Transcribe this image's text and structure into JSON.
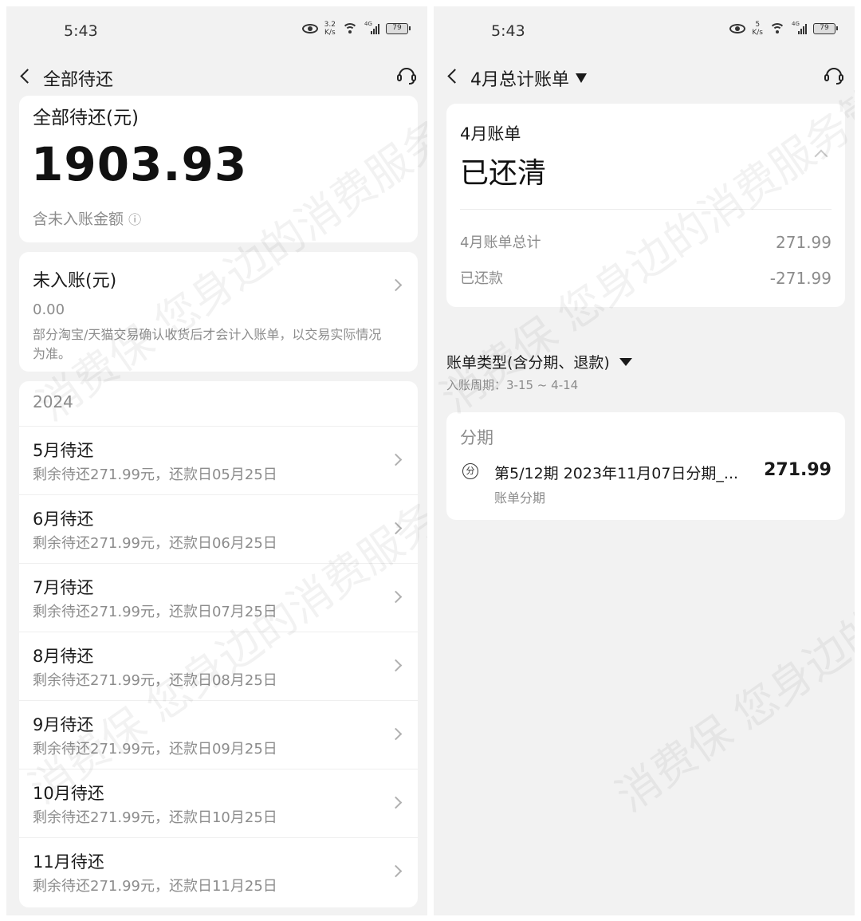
{
  "left": {
    "status": {
      "time": "5:43",
      "speed_value": "3.2",
      "speed_unit": "K/s",
      "network": "4G",
      "battery": "79"
    },
    "nav": {
      "title": "全部待还"
    },
    "summary": {
      "label": "全部待还(元)",
      "amount": "1903.93",
      "note": "含未入账金额",
      "info_icon": "ⓘ"
    },
    "pending": {
      "title": "未入账(元)",
      "amount": "0.00",
      "desc": "部分淘宝/天猫交易确认收货后才会计入账单，以交易实际情况为准。"
    },
    "year": "2024",
    "months": [
      {
        "title": "5月待还",
        "detail": "剩余待还271.99元，还款日05月25日"
      },
      {
        "title": "6月待还",
        "detail": "剩余待还271.99元，还款日06月25日"
      },
      {
        "title": "7月待还",
        "detail": "剩余待还271.99元，还款日07月25日"
      },
      {
        "title": "8月待还",
        "detail": "剩余待还271.99元，还款日08月25日"
      },
      {
        "title": "9月待还",
        "detail": "剩余待还271.99元，还款日09月25日"
      },
      {
        "title": "10月待还",
        "detail": "剩余待还271.99元，还款日10月25日"
      },
      {
        "title": "11月待还",
        "detail": "剩余待还271.99元，还款日11月25日"
      }
    ]
  },
  "right": {
    "status": {
      "time": "5:43",
      "speed_value": "5",
      "speed_unit": "K/s",
      "network": "4G",
      "battery": "79"
    },
    "nav": {
      "title": "4月总计账单"
    },
    "bill": {
      "label": "4月账单",
      "status": "已还清",
      "total_label": "4月账单总计",
      "total_value": "271.99",
      "paid_label": "已还款",
      "paid_value": "-271.99"
    },
    "filter": {
      "label": "账单类型(含分期、退款)",
      "period": "入账周期：3-15 ~ 4-14"
    },
    "installment": {
      "section": "分期",
      "icon_char": "分",
      "title": "第5/12期 2023年11月07日分期_...",
      "sub": "账单分期",
      "amount": "271.99"
    }
  },
  "watermark": "消费保 您身边的消费服务管家"
}
